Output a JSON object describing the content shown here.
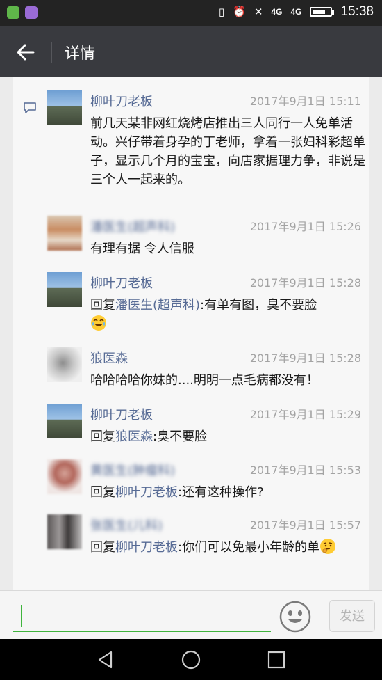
{
  "status_bar": {
    "time": "15:38",
    "network_1": "4G",
    "network_2": "4G",
    "battery_level": 0.75,
    "icons": [
      "wechat-icon",
      "gallery-icon",
      "vibrate-icon",
      "alarm-icon",
      "no-sim-icon",
      "signal-icon",
      "battery-icon"
    ]
  },
  "title_bar": {
    "title": "详情",
    "back_icon": "back-arrow-icon"
  },
  "comments": [
    {
      "name": "柳叶刀老板",
      "time": "2017年9月1日 15:11",
      "text": "前几天某非网红烧烤店推出三人同行一人免单活动。兴仔带着身孕的丁老师，拿着一张妇科彩超单子，显示几个月的宝宝，向店家据理力争，非说是三个人一起来的。"
    },
    {
      "name": "潘医生(超声科)",
      "time": "2017年9月1日 15:26",
      "text": "有理有据 令人信服"
    },
    {
      "name": "柳叶刀老板",
      "time": "2017年9月1日 15:28",
      "reply_prefix": "回复",
      "reply_to": "潘医生(超声科)",
      "text": ":有单有图，臭不要脸",
      "emoji": "laugh-cry-emoji"
    },
    {
      "name": "狼医森",
      "time": "2017年9月1日 15:28",
      "text": "哈哈哈哈你妹的....明明一点毛病都没有！"
    },
    {
      "name": "柳叶刀老板",
      "time": "2017年9月1日 15:29",
      "reply_prefix": "回复",
      "reply_to": "狼医森",
      "text": ":臭不要脸"
    },
    {
      "name": "黄医生(肿瘤科)",
      "time": "2017年9月1日 15:53",
      "reply_prefix": "回复",
      "reply_to": "柳叶刀老板",
      "text": ":还有这种操作?"
    },
    {
      "name": "张医生(儿科)",
      "time": "2017年9月1日 15:57",
      "reply_prefix": "回复",
      "reply_to": "柳叶刀老板",
      "text": ":你们可以免最小年龄的单",
      "emoji": "thinking-emoji"
    }
  ],
  "input_bar": {
    "value": "",
    "send_label": "发送",
    "emoji_icon": "smile-icon"
  },
  "nav_bar": {
    "icons": [
      "back-triangle-icon",
      "home-circle-icon",
      "recents-square-icon"
    ]
  },
  "colors": {
    "link": "#576b95",
    "accent": "#3fb43d",
    "titlebar": "#393a3f",
    "timestamp": "#a3a3a3"
  }
}
